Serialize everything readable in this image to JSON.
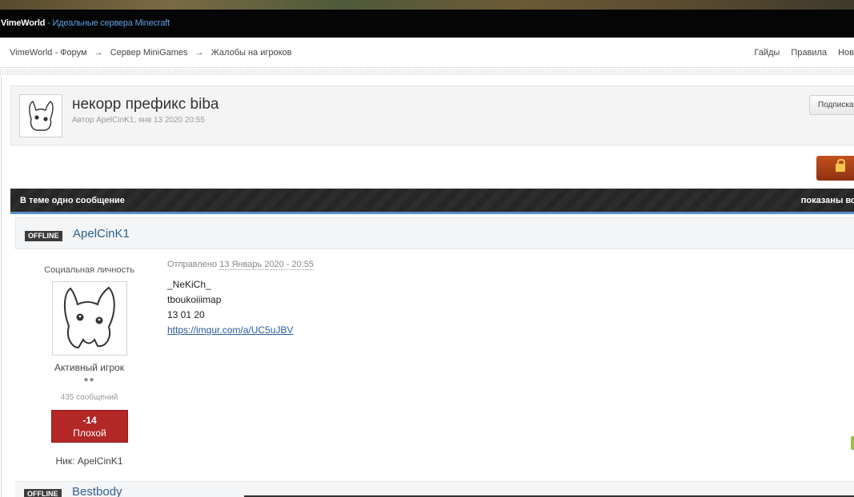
{
  "site": {
    "brand": "VimeWorld",
    "tagline": " - Идеальные сервера Minecraft"
  },
  "breadcrumb": {
    "items": [
      "VimeWorld - Форум",
      "Сервер MiniGames",
      "Жалобы на игроков"
    ],
    "separator": "→"
  },
  "nav": {
    "items": [
      "Гайды",
      "Правила",
      "Нов"
    ]
  },
  "topic": {
    "title": "некорр префикс biba",
    "meta": "Автор ApelCinK1, янв 13 2020 20:55",
    "subscribe_label": "Подписка"
  },
  "postsbar": {
    "left": "В теме одно сообщение",
    "right": "показаны вс"
  },
  "post": {
    "status_badge": "OFFLINE",
    "author": "ApelCinK1",
    "user_title": "Социальная личность",
    "rank": "Активный игрок",
    "pips": "●●",
    "post_count": "435 сообщений",
    "rep_value": "-14",
    "rep_label": "Плохой",
    "nick": "Ник: ApelCinK1",
    "date_prefix": "Отправлено ",
    "date": "13 Январь 2020 - 20:55",
    "lines": [
      "_NeKiCh_",
      "tboukoiiimap",
      "13 01 20"
    ],
    "link": "https://imgur.com/a/UC5uJBV"
  },
  "next_post": {
    "status_badge": "OFFLINE",
    "author": "Bestbody"
  },
  "colors": {
    "accent_blue": "#5b8ec8",
    "rep_bad": "#b42727",
    "closed_button": "#a8421a",
    "link": "#2b5a9c"
  },
  "icons": {
    "lock": "lock-icon",
    "avatar": "bunny-avatar-icon"
  }
}
